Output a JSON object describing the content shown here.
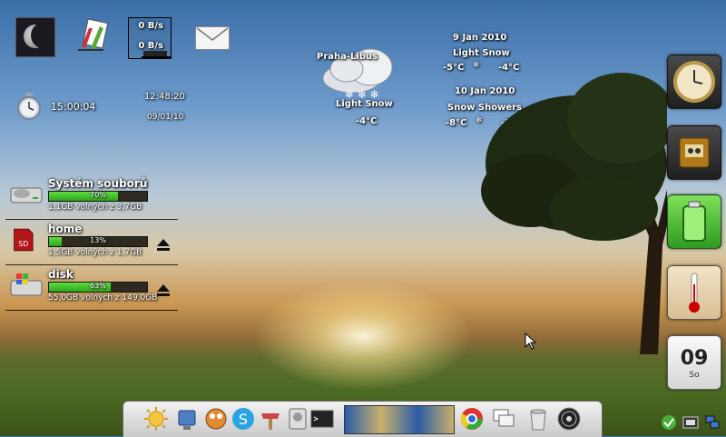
{
  "network": {
    "download": "0 B/s",
    "upload": "0 B/s"
  },
  "alarm": {
    "time": "15:00:04"
  },
  "clock": {
    "time": "12:48:20",
    "date": "09/01/10"
  },
  "disks": [
    {
      "name": "Systém souborů",
      "percent_text": "70%",
      "percent": 70,
      "free_text": "1,1GB volných z 3,7GB"
    },
    {
      "name": "home",
      "percent_text": "13%",
      "percent": 13,
      "free_text": "1,5GB volných z 1,7GB"
    },
    {
      "name": "disk",
      "percent_text": "63%",
      "percent": 63,
      "free_text": "55,0GB volných z 149,0GB"
    }
  ],
  "weather": {
    "location": "Praha-Libus",
    "current": {
      "condition": "Light Snow",
      "temp": "-4°C"
    },
    "forecast": [
      {
        "date": "9 Jan 2010",
        "condition": "Light Snow",
        "low": "-5°C",
        "high": "-4°C"
      },
      {
        "date": "10 Jan 2010",
        "condition": "Snow Showers",
        "low": "-8°C",
        "high": "-3°C"
      }
    ]
  },
  "calendar": {
    "day": "09",
    "weekday": "So"
  },
  "icons": {
    "dock_left": [
      "weather-sun-icon",
      "finder-icon",
      "gimp-icon",
      "skype-icon",
      "tools-icon",
      "disk-utility-icon",
      "terminal-icon"
    ],
    "dock_right": [
      "chrome-icon",
      "windows-icon",
      "trash-icon",
      "dvd-icon"
    ]
  },
  "colors": {
    "bar_fill": "#3fbf25",
    "bar_bg": "#2e2a20"
  }
}
